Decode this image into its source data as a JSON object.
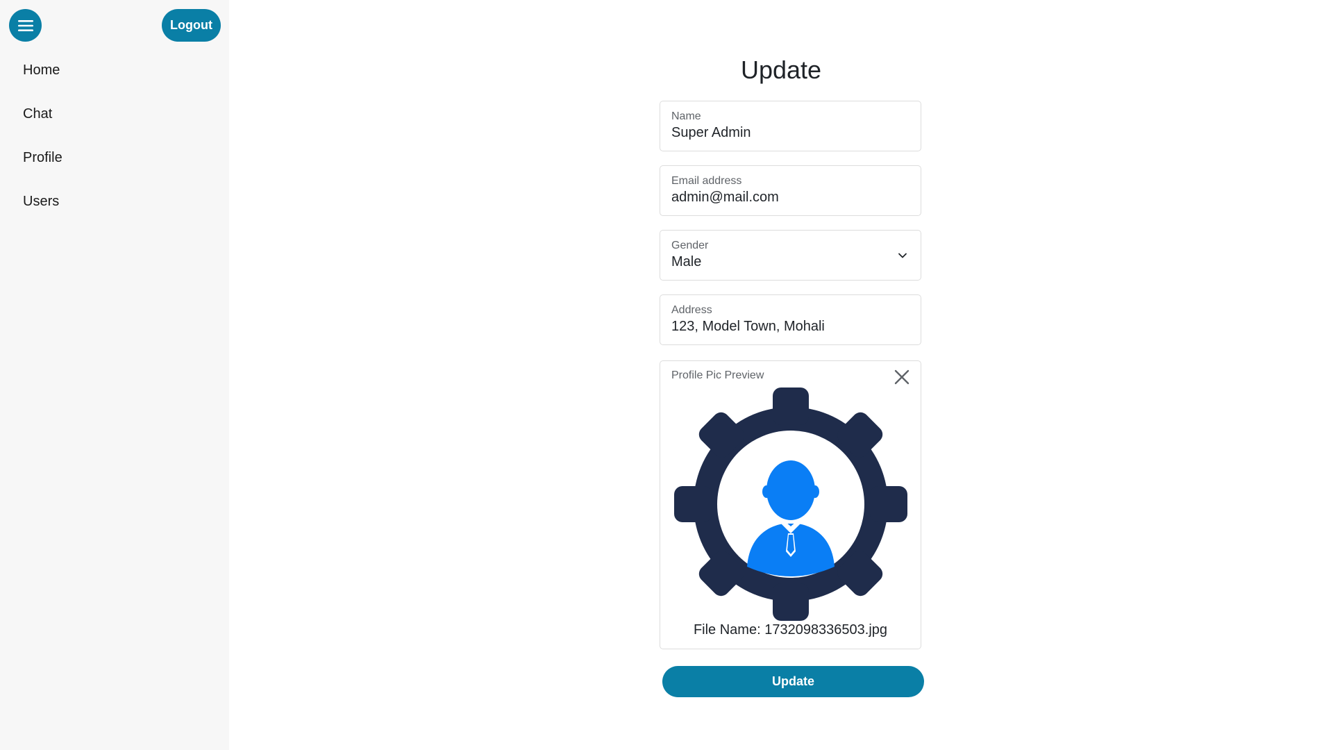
{
  "header": {
    "menu_icon": "hamburger-menu-icon",
    "logout_label": "Logout"
  },
  "sidebar": {
    "items": [
      {
        "label": "Home"
      },
      {
        "label": "Chat"
      },
      {
        "label": "Profile"
      },
      {
        "label": "Users"
      }
    ]
  },
  "form": {
    "title": "Update",
    "name": {
      "label": "Name",
      "value": "Super Admin"
    },
    "email": {
      "label": "Email address",
      "value": "admin@mail.com"
    },
    "gender": {
      "label": "Gender",
      "value": "Male"
    },
    "address": {
      "label": "Address",
      "value": "123, Model Town, Mohali"
    },
    "preview": {
      "label": "Profile Pic Preview",
      "file_name": "File Name: 1732098336503.jpg"
    },
    "submit_label": "Update"
  },
  "colors": {
    "accent": "#0a7fa6",
    "gear": "#1f2c4b",
    "user_icon": "#0a7ef5"
  }
}
